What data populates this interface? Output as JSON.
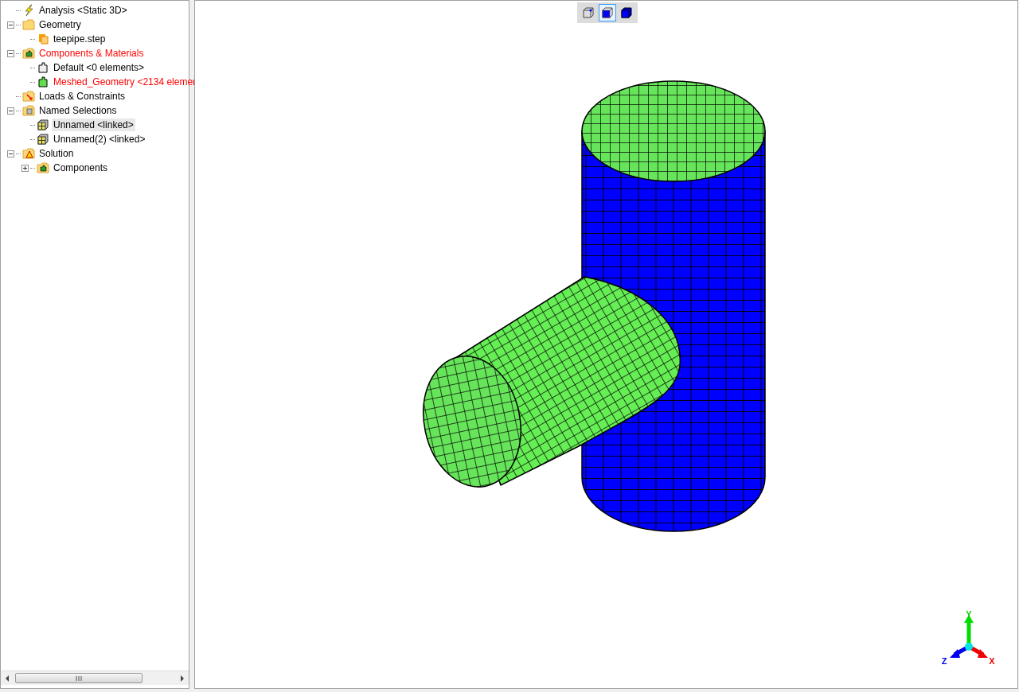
{
  "tree": {
    "items": [
      {
        "label": "Analysis <Static 3D>",
        "kind": "analysis",
        "color": "#000000",
        "selected": false
      },
      {
        "label": "Geometry",
        "kind": "folder",
        "color": "#000000",
        "selected": false,
        "expanded": true,
        "children": [
          {
            "label": "teepipe.step",
            "kind": "file",
            "color": "#000000",
            "selected": false
          }
        ]
      },
      {
        "label": "Components & Materials",
        "kind": "component-folder",
        "color": "#ff0000",
        "selected": false,
        "expanded": true,
        "children": [
          {
            "label": "Default <0 elements>",
            "kind": "component-empty",
            "color": "#000000",
            "selected": false
          },
          {
            "label": "Meshed_Geometry <2134 elemer",
            "kind": "component-meshed",
            "color": "#ff0000",
            "selected": false
          }
        ]
      },
      {
        "label": "Loads & Constraints",
        "kind": "loads-folder",
        "color": "#000000",
        "selected": false
      },
      {
        "label": "Named Selections",
        "kind": "selection-folder",
        "color": "#000000",
        "selected": false,
        "expanded": true,
        "children": [
          {
            "label": "Unnamed <linked>",
            "kind": "selection",
            "color": "#000000",
            "selected": true
          },
          {
            "label": "Unnamed(2) <linked>",
            "kind": "selection",
            "color": "#000000",
            "selected": false
          }
        ]
      },
      {
        "label": "Solution",
        "kind": "solution-folder",
        "color": "#000000",
        "selected": false,
        "expanded": true,
        "children": [
          {
            "label": "Components",
            "kind": "component-folder",
            "color": "#000000",
            "selected": false,
            "expanded": false
          }
        ]
      }
    ]
  },
  "view_toolbar": [
    {
      "kind": "wireframe",
      "selected": false
    },
    {
      "kind": "shaded-edges",
      "selected": true
    },
    {
      "kind": "shaded",
      "selected": false
    }
  ],
  "axes": {
    "x": "X",
    "y": "Y",
    "z": "Z"
  }
}
